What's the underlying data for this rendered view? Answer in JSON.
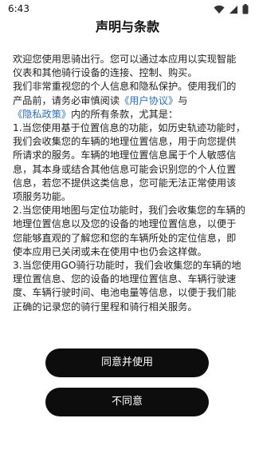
{
  "status": {
    "time": "6:43"
  },
  "title": "声明与条款",
  "body": {
    "p1": "欢迎您使用思骑出行。您可以通过本应用以实现智能仪表和其他骑行设备的连接、控制、购买。",
    "p2_before": "我们非常重视您的个人信息和隐私保护。使用我们的产品前，请务必审慎阅读",
    "link_user_agreement": "《用户协议》",
    "p2_and": "与",
    "link_privacy_policy": "《隐私政策》",
    "p2_after": "内的所有条款，尤其是：",
    "item1": " 1.当您使用基于位置信息的功能，如历史轨迹功能时，我们会收集您的车辆的地理位置信息，用于向您提供所请求的服务。车辆的地理位置信息属于个人敏感信息，其本身或结合其他信息可能会识别您的个人位置信息，若您不提供这类信息，您可能无法正常使用该项服务功能。",
    "item2": " 2.当您使用地图与定位功能时，我们会收集您的车辆的地理位置信息以及您的设备的地理位置信息，以便于您能够直观的了解您和您的车辆所处的定位信息，即使本应用已关闭或未在使用中也仍会这样做。",
    "item3": " 3.当您使用GO骑行功能时，我们会收集您的车辆的地理位置信息、您的设备的地理位置信息、车辆行驶速度、车辆行驶时间、电池电量等信息，以便于我们能正确的记录您的骑行里程和骑行相关服务。"
  },
  "buttons": {
    "agree": "同意并使用",
    "disagree": "不同意"
  }
}
